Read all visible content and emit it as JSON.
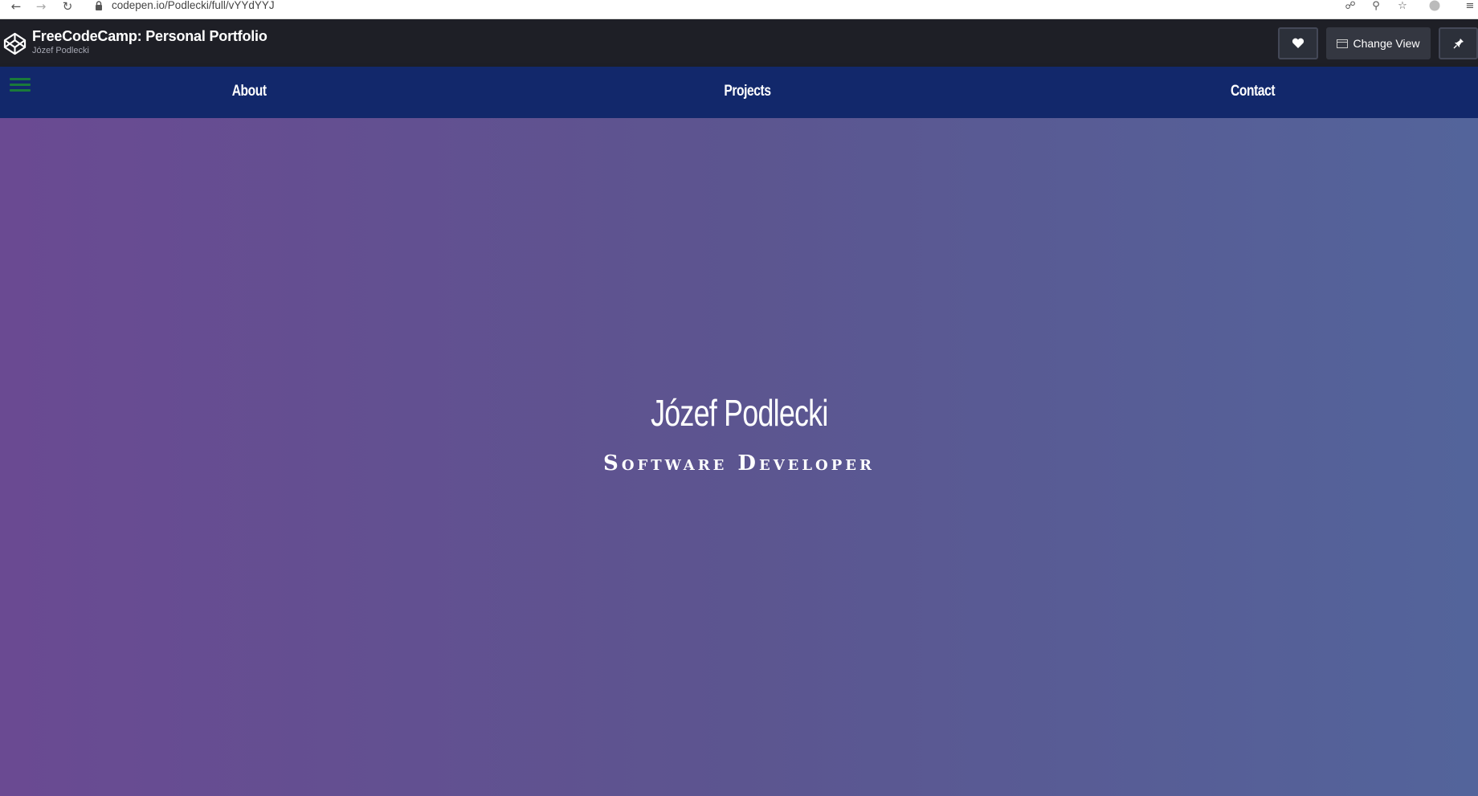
{
  "browser": {
    "url": "codepen.io/Podlecki/full/vYYdYYJ",
    "back_icon": "arrow-left-icon",
    "forward_icon": "arrow-right-icon",
    "reload_icon": "reload-icon",
    "lock_icon": "lock-icon",
    "right_icons": [
      "translate-icon",
      "zoom-icon",
      "star-icon",
      "profile-icon",
      "menu-icon"
    ]
  },
  "codepen_header": {
    "title": "FreeCodeCamp: Personal Portfolio",
    "author": "Józef Podlecki",
    "heart_icon": "heart-icon",
    "change_view_label": "Change View",
    "change_view_icon": "layout-icon",
    "pin_icon": "pin-icon"
  },
  "nav": {
    "menu_icon": "hamburger-icon",
    "links": [
      {
        "label": "About"
      },
      {
        "label": "Projects"
      },
      {
        "label": "Contact"
      }
    ]
  },
  "hero": {
    "name": "Józef Podlecki",
    "role": "Software Developer"
  },
  "colors": {
    "codepen_header_bg": "#1e1f26",
    "nav_bg": "#12286b",
    "hero_gradient_left": "#6a4a92",
    "hero_gradient_right": "#53649b"
  }
}
